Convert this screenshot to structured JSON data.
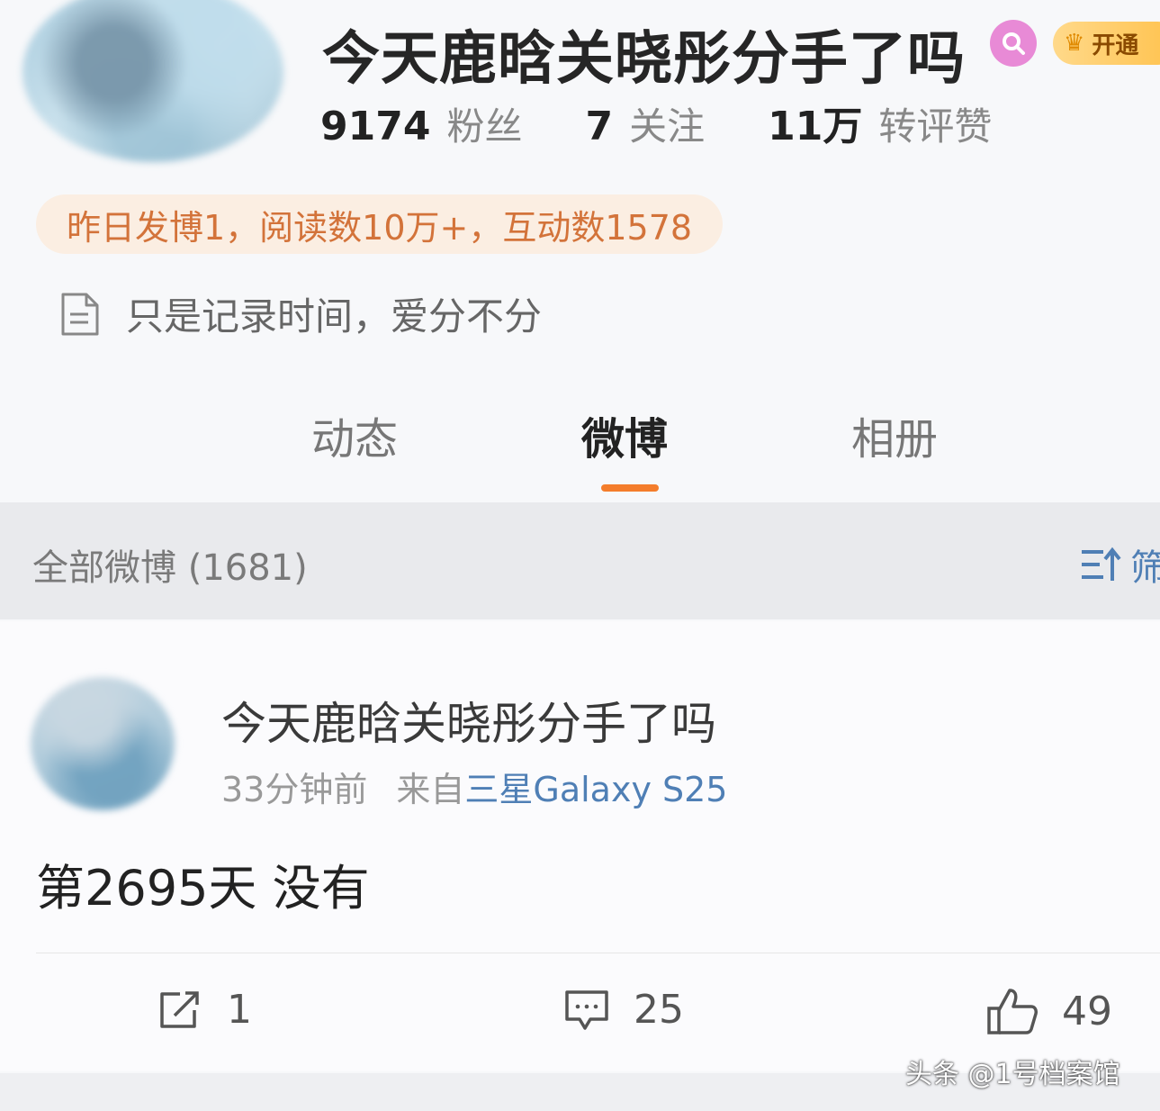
{
  "profile": {
    "name": "今天鹿晗关晓彤分手了吗",
    "vip_label": "开通",
    "stats": [
      {
        "value": "9174",
        "label": "粉丝"
      },
      {
        "value": "7",
        "label": "关注"
      },
      {
        "value": "11万",
        "label": "转评赞"
      }
    ],
    "activity": "昨日发博1，阅读数10万+，互动数1578",
    "bio": "只是记录时间，爱分不分"
  },
  "tabs": [
    {
      "label": "动态",
      "active": false
    },
    {
      "label": "微博",
      "active": true
    },
    {
      "label": "相册",
      "active": false
    }
  ],
  "filter": {
    "label": "全部微博 (1681)",
    "button_label": "筛"
  },
  "post": {
    "author": "今天鹿晗关晓彤分手了吗",
    "time": "33分钟前",
    "source_prefix": "来自",
    "source_device": "三星Galaxy S25",
    "content": "第2695天 没有",
    "reposts": "1",
    "comments": "25",
    "likes": "49"
  },
  "watermark": "头条 @1号档案馆",
  "colors": {
    "accent": "#f47d2b",
    "link": "#4f7fb5",
    "activity_text": "#d3733a",
    "activity_bg": "#fbeee2"
  }
}
